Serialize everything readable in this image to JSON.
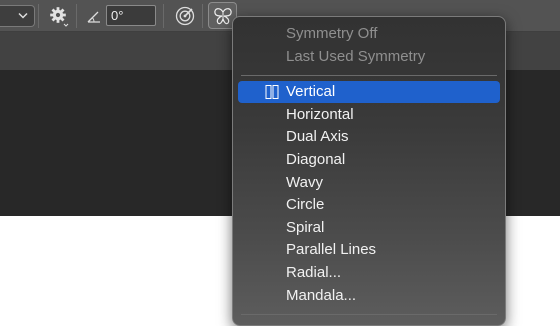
{
  "options_bar": {
    "angle_value": "0°"
  },
  "symmetry_menu": {
    "items": [
      {
        "label": "Symmetry Off",
        "enabled": false,
        "selected": false
      },
      {
        "label": "Last Used Symmetry",
        "enabled": false,
        "selected": false
      },
      {
        "label": "Vertical",
        "enabled": true,
        "selected": true
      },
      {
        "label": "Horizontal",
        "enabled": true,
        "selected": false
      },
      {
        "label": "Dual Axis",
        "enabled": true,
        "selected": false
      },
      {
        "label": "Diagonal",
        "enabled": true,
        "selected": false
      },
      {
        "label": "Wavy",
        "enabled": true,
        "selected": false
      },
      {
        "label": "Circle",
        "enabled": true,
        "selected": false
      },
      {
        "label": "Spiral",
        "enabled": true,
        "selected": false
      },
      {
        "label": "Parallel Lines",
        "enabled": true,
        "selected": false
      },
      {
        "label": "Radial...",
        "enabled": true,
        "selected": false
      },
      {
        "label": "Mandala...",
        "enabled": true,
        "selected": false
      }
    ],
    "highlight_color": "#1f61cc"
  },
  "icons": {
    "dropdown": "chevron-down-icon",
    "brush_settings": "gear-icon",
    "angle": "angle-icon",
    "pressure": "pressure-target-icon",
    "symmetry": "butterfly-icon",
    "selected_mark": "vertical-symmetry-icon"
  },
  "colors": {
    "toolbar_bg": "#535353",
    "workspace_bg": "#282828",
    "canvas_bg": "#ffffff",
    "menu_text": "#f1f1f1",
    "menu_disabled_text": "#8f8f8f"
  }
}
